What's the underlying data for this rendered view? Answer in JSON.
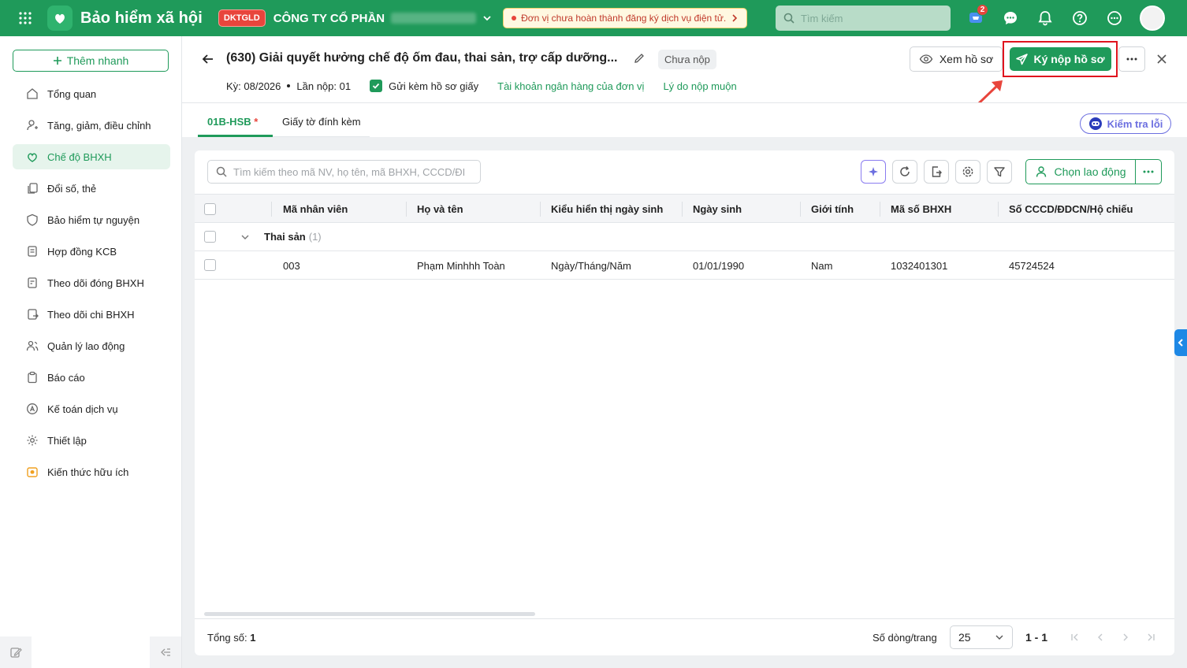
{
  "topbar": {
    "app_title": "Bảo hiểm xã hội",
    "org_code": "DKTGLD",
    "company_name": "CÔNG TY CỔ PHẦN",
    "notice": "Đơn vị chưa hoàn thành đăng ký dịch vụ điện tử.",
    "search_placeholder": "Tìm kiếm",
    "cart_badge": "2"
  },
  "sidebar": {
    "quick_add": "Thêm nhanh",
    "items": [
      {
        "label": "Tổng quan"
      },
      {
        "label": "Tăng, giảm, điều chỉnh"
      },
      {
        "label": "Chế độ BHXH"
      },
      {
        "label": "Đổi số, thẻ"
      },
      {
        "label": "Bảo hiểm tự nguyện"
      },
      {
        "label": "Hợp đồng KCB"
      },
      {
        "label": "Theo dõi đóng BHXH"
      },
      {
        "label": "Theo dõi chi BHXH"
      },
      {
        "label": "Quản lý lao động"
      },
      {
        "label": "Báo cáo"
      },
      {
        "label": "Kế toán dịch vụ"
      },
      {
        "label": "Thiết lập"
      },
      {
        "label": "Kiến thức hữu ích"
      }
    ]
  },
  "header": {
    "title": "(630) Giải quyết hưởng chế độ ốm đau, thai sản, trợ cấp dưỡng...",
    "status": "Chưa nộp",
    "period": "Kỳ: 08/2026",
    "submit_count": "Lần nộp: 01",
    "attach_paper": "Gửi kèm hồ sơ giấy",
    "bank_account_link": "Tài khoản ngân hàng của đơn vị",
    "late_reason_link": "Lý do nộp muộn",
    "view_button": "Xem hồ sơ",
    "sign_button": "Ký nộp hồ sơ"
  },
  "tabs": {
    "tab1": "01B-HSB",
    "tab1_required": "*",
    "tab2": "Giấy tờ đính kèm",
    "check_errors": "Kiểm tra lỗi"
  },
  "grid": {
    "search_placeholder": "Tìm kiếm theo mã NV, họ tên, mã BHXH, CCCD/ĐI",
    "choose_button": "Chọn lao động",
    "columns": [
      "Mã nhân viên",
      "Họ và tên",
      "Kiểu hiển thị ngày sinh",
      "Ngày sinh",
      "Giới tính",
      "Mã số BHXH",
      "Số CCCD/ĐDCN/Hộ chiếu"
    ],
    "group": {
      "label": "Thai sản",
      "count": "(1)"
    },
    "rows": [
      {
        "employee_id": "003",
        "name": "Phạm Minhhh Toàn",
        "dob_format": "Ngày/Tháng/Năm",
        "dob": "01/01/1990",
        "gender": "Nam",
        "bhxh_code": "1032401301",
        "id_number": "45724524"
      }
    ]
  },
  "footer": {
    "total_label": "Tổng số:",
    "total_value": "1",
    "rows_per_page_label": "Số dòng/trang",
    "rows_per_page": "25",
    "range": "1 - 1"
  },
  "colors": {
    "brand_green": "#1f9a5a",
    "alert_red": "#e8453c",
    "highlight_red": "#e0141e",
    "ai_purple": "#6c6fe0"
  }
}
